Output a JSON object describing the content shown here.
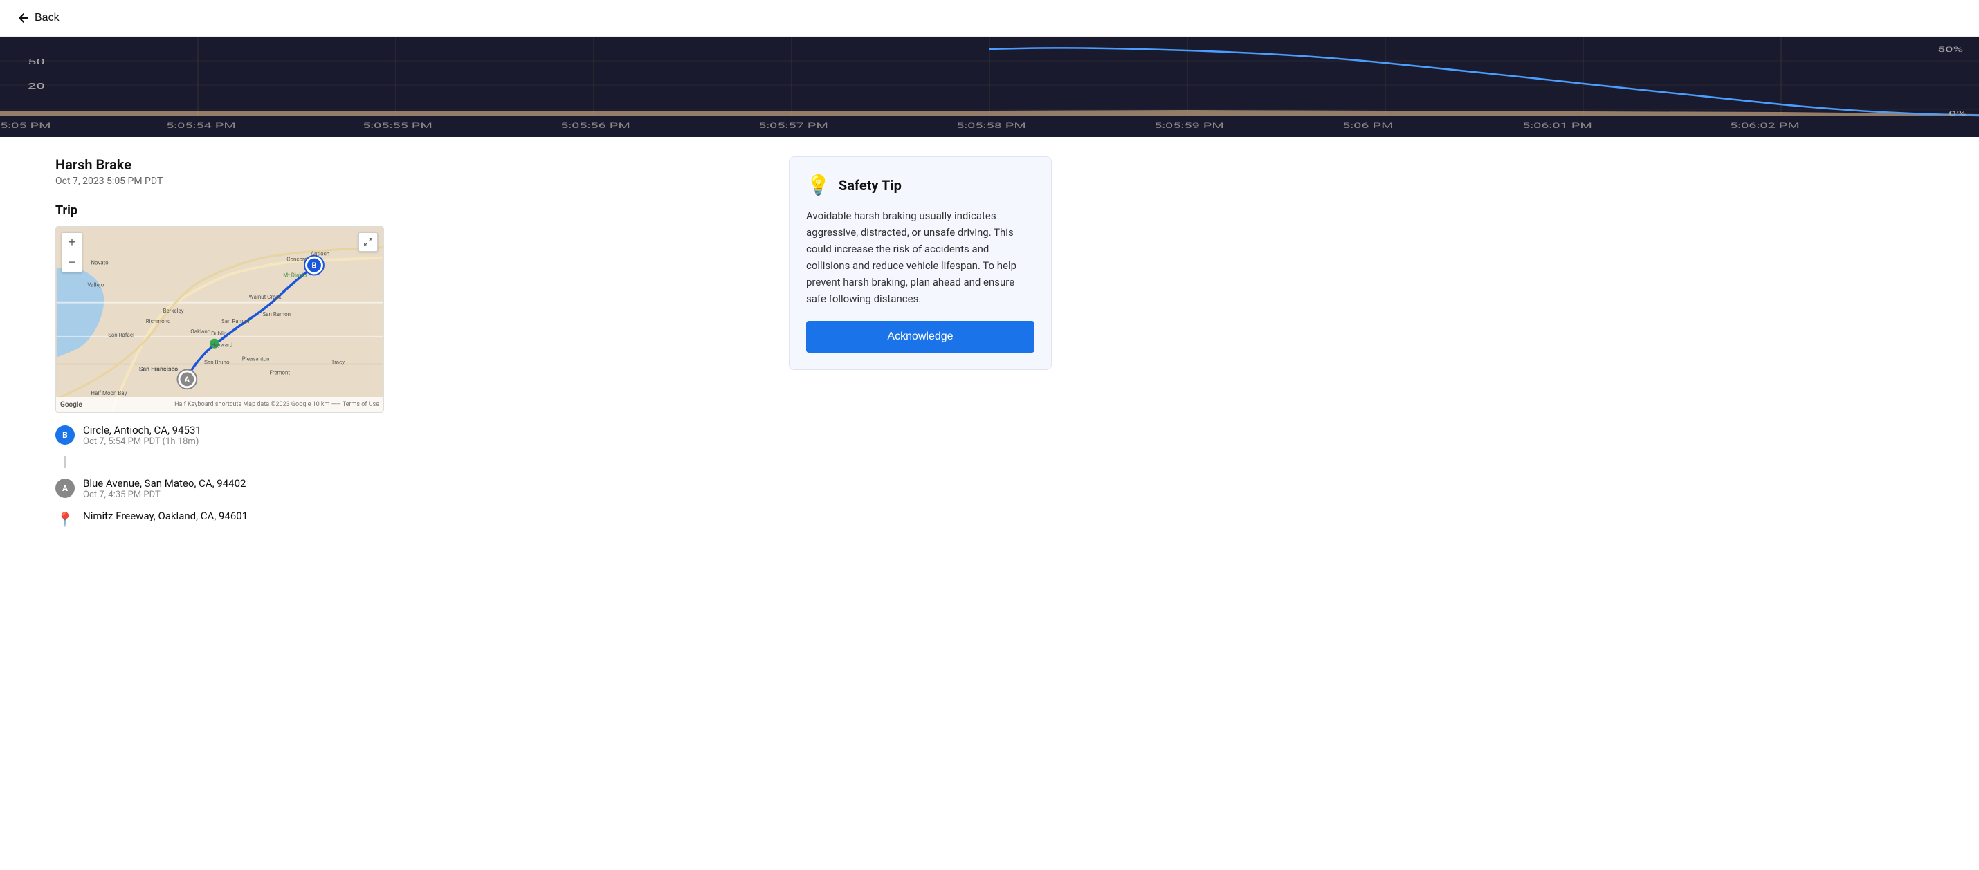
{
  "header": {
    "back_label": "Back"
  },
  "chart": {
    "y_labels": [
      "50",
      "20"
    ],
    "y_right_top": "50%",
    "y_right_bottom": "0%",
    "x_labels": [
      "5:05 PM",
      "5:05:54 PM",
      "5:05:55 PM",
      "5:05:56 PM",
      "5:05:57 PM",
      "5:05:58 PM",
      "5:05:59 PM",
      "5:06 PM",
      "5:06:01 PM",
      "5:06:02 PM"
    ]
  },
  "event": {
    "title": "Harsh Brake",
    "date": "Oct 7, 2023 5:05 PM PDT"
  },
  "trip": {
    "label": "Trip",
    "waypoints": [
      {
        "icon_type": "b",
        "icon_label": "B",
        "address": "Circle, Antioch, CA, 94531",
        "time": "Oct 7, 5:54 PM PDT (1h 18m)"
      },
      {
        "icon_type": "a",
        "icon_label": "A",
        "address": "Blue Avenue, San Mateo, CA, 94402",
        "time": "Oct 7, 4:35 PM PDT"
      },
      {
        "icon_type": "pin",
        "icon_label": "📍",
        "address": "Nimitz Freeway, Oakland, CA, 94601",
        "time": ""
      }
    ]
  },
  "safety_tip": {
    "title": "Safety Tip",
    "icon": "💡",
    "body": "Avoidable harsh braking usually indicates aggressive, distracted, or unsafe driving. This could increase the risk of accidents and collisions and reduce vehicle lifespan. To help prevent harsh braking, plan ahead and ensure safe following distances.",
    "acknowledge_label": "Acknowledge"
  },
  "map": {
    "google_label": "Google",
    "footer_text": "Half  Keyboard shortcuts  Map data ©2023 Google  10 km ——  Terms of Use"
  }
}
